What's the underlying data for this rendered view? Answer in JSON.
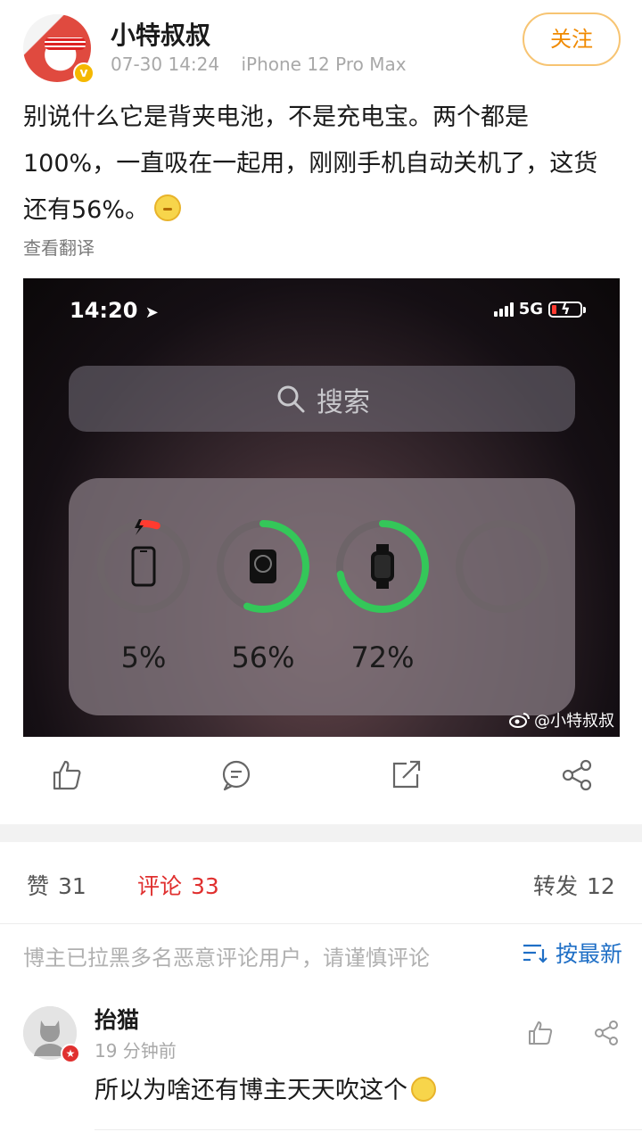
{
  "post": {
    "author": "小特叔叔",
    "date": "07-30 14:24",
    "device": "iPhone 12 Pro Max",
    "follow_label": "关注",
    "text": "别说什么它是背夹电池，不是充电宝。两个都是100%，一直吸在一起用，刚刚手机自动关机了，这货还有56%。",
    "translate_label": "查看翻译"
  },
  "screenshot": {
    "time": "14:20",
    "network": "5G",
    "search_placeholder": "搜索",
    "batteries": [
      {
        "device": "iphone-icon",
        "percent": 5,
        "label": "5%",
        "color": "#ff3b30"
      },
      {
        "device": "magsafe-battery-icon",
        "percent": 56,
        "label": "56%",
        "color": "#34c759"
      },
      {
        "device": "watch-icon",
        "percent": 72,
        "label": "72%",
        "color": "#34c759"
      },
      {
        "device": "empty-slot",
        "percent": 0,
        "label": "",
        "color": "#8a8085"
      }
    ],
    "watermark": "@小特叔叔"
  },
  "stats": {
    "likes_label": "赞",
    "likes_count": "31",
    "comments_label": "评论",
    "comments_count": "33",
    "reposts_label": "转发",
    "reposts_count": "12"
  },
  "comments_header": {
    "notice": "博主已拉黑多名恶意评论用户，请谨慎评论",
    "sort_label": "按最新"
  },
  "comment": {
    "user": "抬猫",
    "time": "19 分钟前",
    "text": "所以为啥还有博主天天吹这个"
  },
  "colors": {
    "accent_red": "#e0302f",
    "link_blue": "#1f6fc6",
    "follow_orange": "#f08a00",
    "ring_green": "#34c759"
  }
}
